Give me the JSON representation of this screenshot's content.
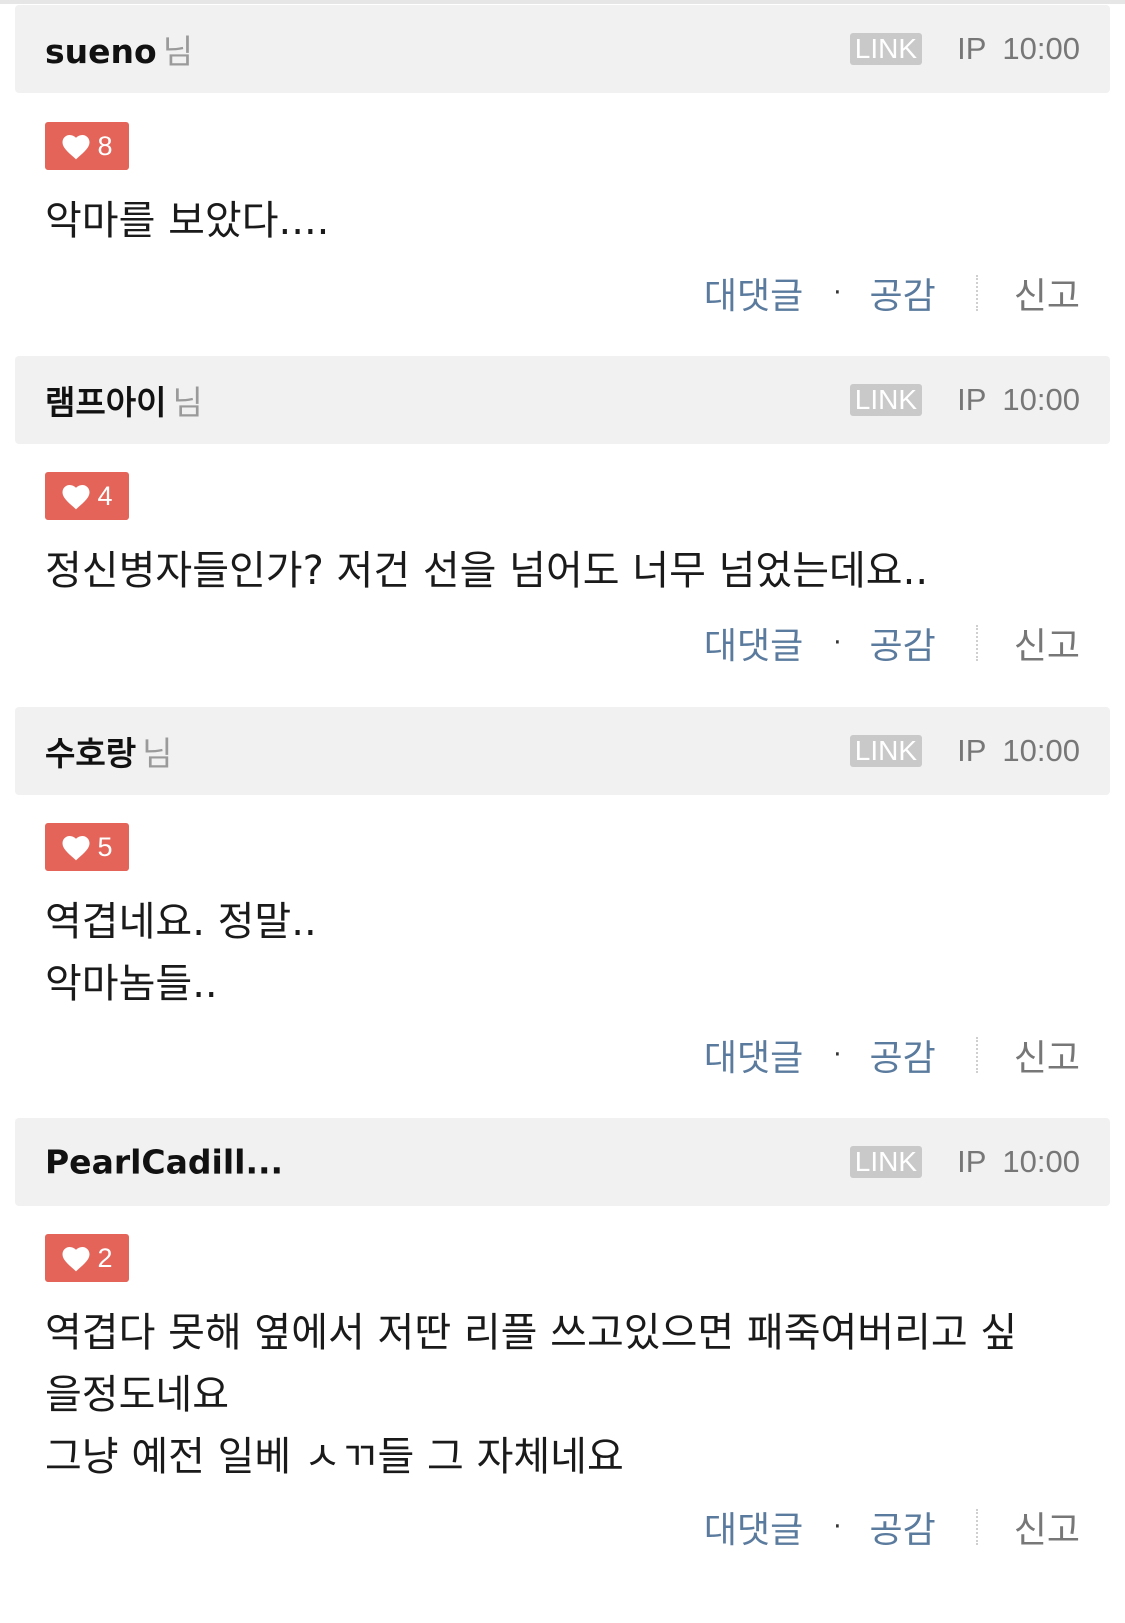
{
  "comments": [
    {
      "author": "sueno",
      "author_suffix": "님",
      "link_label": "LINK",
      "ip_label": "IP",
      "time": "10:00",
      "likes": "8",
      "text": "악마를 보았다....",
      "actions": {
        "reply": "대댓글",
        "separator": "·",
        "agree": "공감",
        "report": "신고"
      }
    },
    {
      "author": "램프아이",
      "author_suffix": "님",
      "link_label": "LINK",
      "ip_label": "IP",
      "time": "10:00",
      "likes": "4",
      "text": "정신병자들인가? 저건 선을 넘어도 너무 넘었는데요..",
      "actions": {
        "reply": "대댓글",
        "separator": "·",
        "agree": "공감",
        "report": "신고"
      }
    },
    {
      "author": "수호랑",
      "author_suffix": "님",
      "link_label": "LINK",
      "ip_label": "IP",
      "time": "10:00",
      "likes": "5",
      "text": "역겹네요. 정말..\n악마놈들..",
      "actions": {
        "reply": "대댓글",
        "separator": "·",
        "agree": "공감",
        "report": "신고"
      }
    },
    {
      "author": "PearlCadill...",
      "author_suffix": "",
      "link_label": "LINK",
      "ip_label": "IP",
      "time": "10:00",
      "likes": "2",
      "text": "역겹다 못해 옆에서 저딴 리플 쓰고있으면 패죽여버리고 싶\n을정도네요\n그냥 예전 일베 ㅅㄲ들 그 자체네요",
      "actions": {
        "reply": "대댓글",
        "separator": "·",
        "agree": "공감",
        "report": "신고"
      }
    }
  ],
  "icons": {
    "like": "heart-icon"
  },
  "colors": {
    "header_bg": "#f1f1f1",
    "like_badge": "#e46459",
    "link_badge": "#c9c9c9",
    "action_text": "#5b7b9e",
    "muted_text": "#777777"
  }
}
